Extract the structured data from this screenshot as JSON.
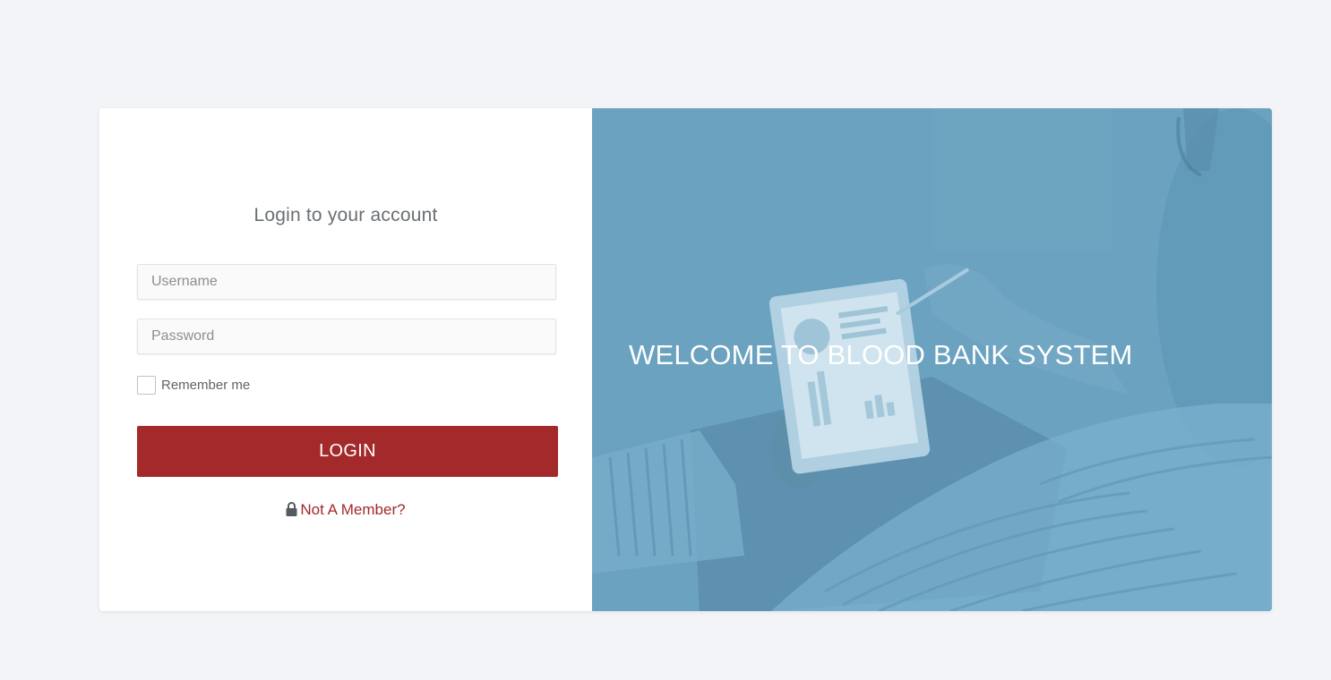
{
  "login_form": {
    "title": "Login to your account",
    "username_placeholder": "Username",
    "username_value": "",
    "password_placeholder": "Password",
    "password_value": "",
    "remember_label": "Remember me",
    "remember_checked": false,
    "login_button_label": "LOGIN",
    "member_link_label": "Not A Member?",
    "member_link_icon": "lock-icon"
  },
  "hero": {
    "heading": "WELCOME TO BLOOD BANK SYSTEM",
    "overlay_color": "#6aa2bf"
  },
  "colors": {
    "page_background": "#f2f4f8",
    "accent": "#a3292a",
    "hero_overlay": "#6aa2bf"
  }
}
